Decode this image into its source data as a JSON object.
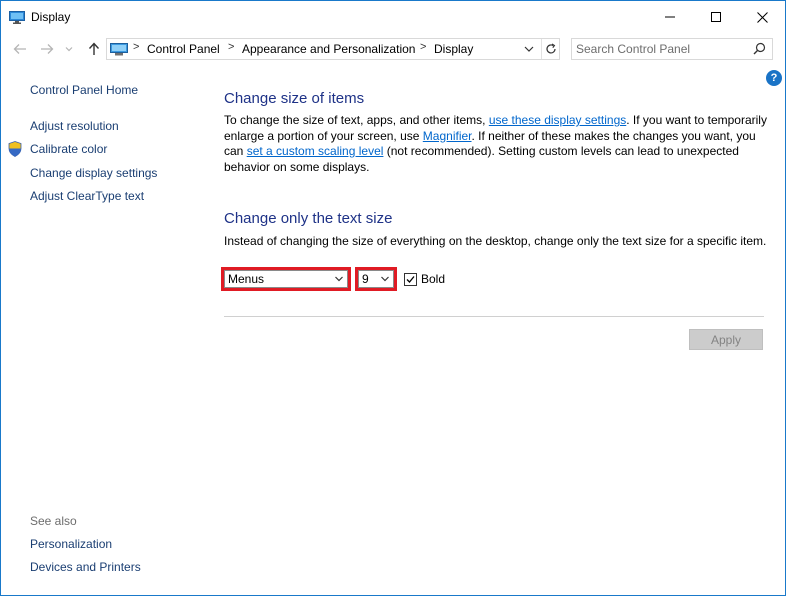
{
  "window": {
    "title": "Display"
  },
  "address": {
    "crumbs": [
      "Control Panel",
      "Appearance and Personalization",
      "Display"
    ]
  },
  "search": {
    "placeholder": "Search Control Panel"
  },
  "help": {
    "label": "?"
  },
  "sidebar": {
    "home": "Control Panel Home",
    "items": [
      {
        "label": "Adjust resolution"
      },
      {
        "label": "Calibrate color"
      },
      {
        "label": "Change display settings"
      },
      {
        "label": "Adjust ClearType text"
      }
    ],
    "see_also_label": "See also",
    "see_also": [
      {
        "label": "Personalization"
      },
      {
        "label": "Devices and Printers"
      }
    ]
  },
  "main": {
    "size_heading": "Change size of items",
    "size_para": {
      "t1": "To change the size of text, apps, and other items, ",
      "link1": "use these display settings",
      "t2": ".  If you want to temporarily enlarge a portion of your screen, use ",
      "link2": "Magnifier",
      "t3": ".  If neither of these makes the changes you want, you can ",
      "link3": "set a custom scaling level",
      "t4": " (not recommended).  Setting custom levels can lead to unexpected behavior on some displays."
    },
    "text_heading": "Change only the text size",
    "text_para": "Instead of changing the size of everything on the desktop, change only the text size for a specific item.",
    "item_select": {
      "value": "Menus"
    },
    "size_select": {
      "value": "9"
    },
    "bold": {
      "label": "Bold",
      "checked": true
    },
    "apply_label": "Apply"
  },
  "colors": {
    "accent": "#1e3287",
    "link": "#0066cc",
    "highlight_border": "#e01b24",
    "window_border": "#1979ca"
  }
}
